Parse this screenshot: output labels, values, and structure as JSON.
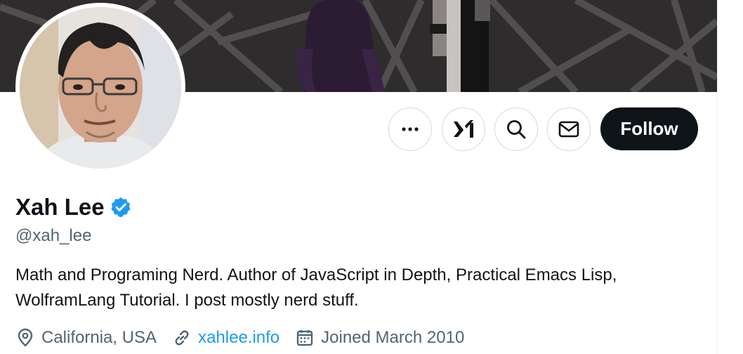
{
  "profile": {
    "display_name": "Xah Lee",
    "handle": "@xah_lee",
    "bio": "Math and Programing Nerd. Author of JavaScript in Depth, Practical Emacs Lisp, WolframLang Tutorial. I post mostly nerd stuff.",
    "location": "California, USA",
    "website": "xahlee.info",
    "joined": "Joined March 2010",
    "verified_color": "#1d9bf0"
  },
  "actions": {
    "more_icon": "more-horizontal-icon",
    "grok_icon": "grok-icon",
    "search_icon": "search-icon",
    "message_icon": "envelope-icon",
    "follow_label": "Follow"
  },
  "colors": {
    "text_primary": "#0f1419",
    "text_secondary": "#536471",
    "link": "#1d9bf0",
    "button_dark": "#0f1419"
  }
}
